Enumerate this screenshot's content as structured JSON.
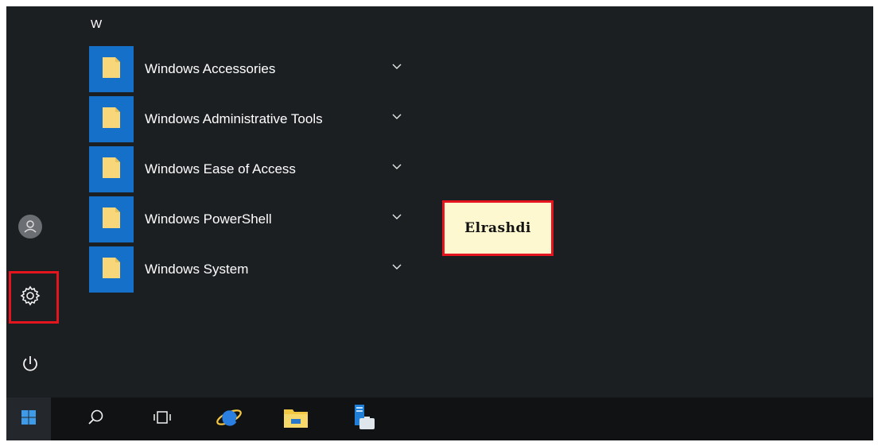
{
  "start_menu": {
    "section_letter": "W",
    "apps": [
      {
        "label": "Windows Accessories"
      },
      {
        "label": "Windows Administrative Tools"
      },
      {
        "label": "Windows Ease of Access"
      },
      {
        "label": "Windows PowerShell"
      },
      {
        "label": "Windows System"
      }
    ],
    "folder_icon": "folder-icon",
    "expand_icon": "chevron-down-icon"
  },
  "left_rail": {
    "items": [
      "user-icon",
      "settings-gear-icon",
      "power-icon"
    ],
    "highlighted": "settings-gear-icon"
  },
  "callout": {
    "text": "Elrashdi"
  },
  "taskbar": {
    "items": [
      "windows-start-icon",
      "search-icon",
      "task-view-icon",
      "internet-explorer-icon",
      "file-explorer-icon",
      "server-manager-icon"
    ]
  },
  "colors": {
    "background": "#1c1f22",
    "taskbar": "#101214",
    "tile": "#1570c9",
    "folder": "#f7d77a",
    "highlight": "#e4151f",
    "callout_bg": "#fdf8cf"
  }
}
